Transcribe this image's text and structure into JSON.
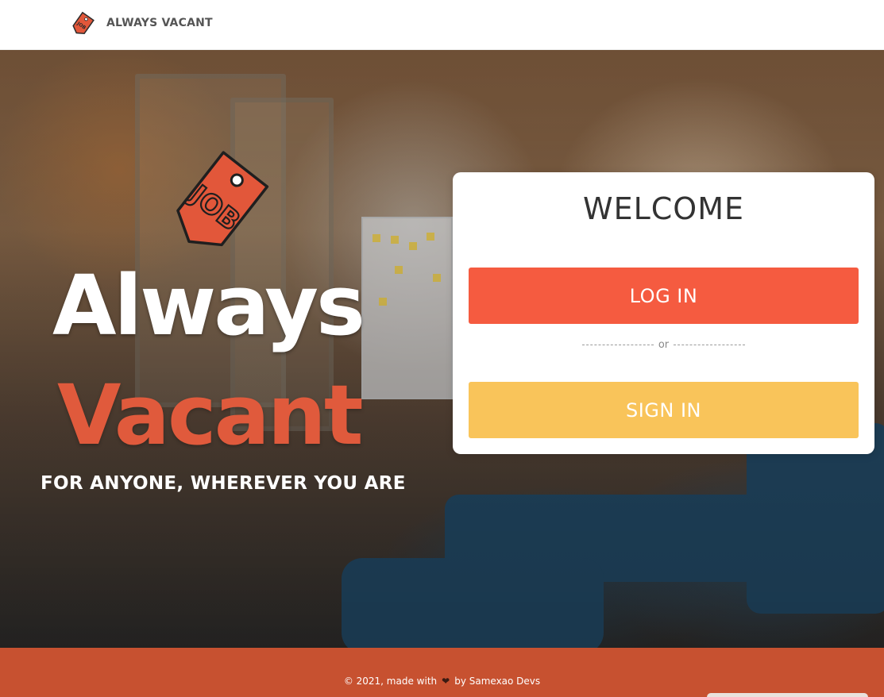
{
  "navbar": {
    "brand_name": "ALWAYS VACANT",
    "logo_icon": "job-tag-icon"
  },
  "hero": {
    "logo_text": "JOB",
    "title_line1": "Always",
    "title_line2": "Vacant",
    "tagline": "FOR ANYONE, WHEREVER YOU ARE"
  },
  "card": {
    "heading": "WELCOME",
    "login_label": "LOG IN",
    "divider_text": "or",
    "signin_label": "SIGN IN"
  },
  "footer": {
    "prefix": "© 2021, made with",
    "heart_icon": "heart-icon",
    "suffix": "by Samexao Devs"
  },
  "colors": {
    "accent_red": "#f55b40",
    "accent_yellow": "#f9c45a",
    "footer_bg": "#c75130",
    "title_vacant": "#e05a3c"
  }
}
